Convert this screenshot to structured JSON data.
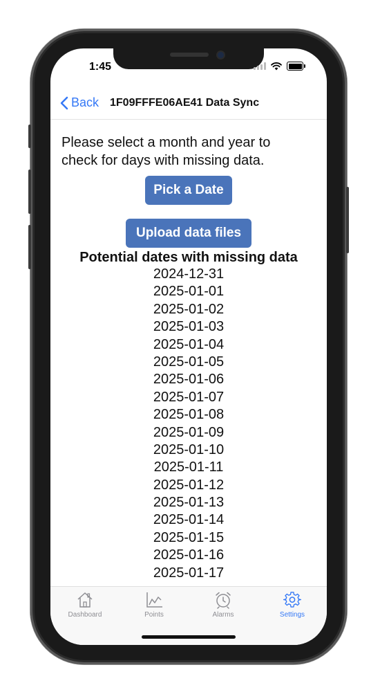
{
  "status_bar": {
    "time": "1:45"
  },
  "nav": {
    "back_label": "Back",
    "title": "1F09FFFE06AE41 Data Sync"
  },
  "main": {
    "instructions": "Please select a month and year to check for days with missing data.",
    "pick_date_label": "Pick a Date",
    "upload_label": "Upload data files",
    "list_header": "Potential dates with missing data",
    "dates": [
      "2024-12-31",
      "2025-01-01",
      "2025-01-02",
      "2025-01-03",
      "2025-01-04",
      "2025-01-05",
      "2025-01-06",
      "2025-01-07",
      "2025-01-08",
      "2025-01-09",
      "2025-01-10",
      "2025-01-11",
      "2025-01-12",
      "2025-01-13",
      "2025-01-14",
      "2025-01-15",
      "2025-01-16",
      "2025-01-17"
    ]
  },
  "tab_bar": {
    "items": [
      {
        "label": "Dashboard",
        "icon": "house-icon"
      },
      {
        "label": "Points",
        "icon": "line-chart-icon"
      },
      {
        "label": "Alarms",
        "icon": "alarm-clock-icon"
      },
      {
        "label": "Settings",
        "icon": "gear-icon",
        "active": true
      }
    ]
  },
  "colors": {
    "accent": "#3478f6",
    "button": "#4a74ba",
    "inactive_tab": "#8e8e93"
  }
}
